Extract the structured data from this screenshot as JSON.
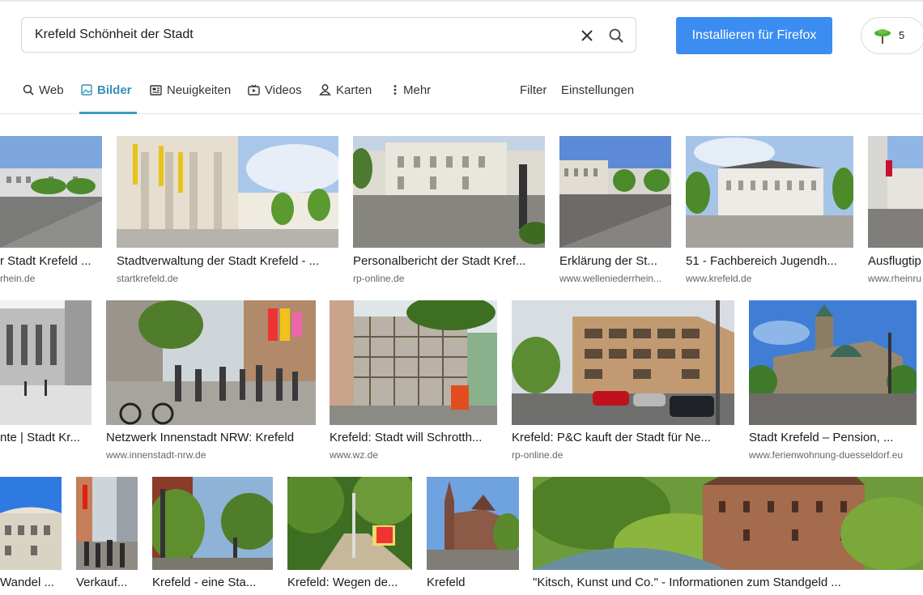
{
  "search": {
    "value": "Krefeld Schönheit der Stadt"
  },
  "install_button": "Installieren für Firefox",
  "tree_count": "5",
  "tabs": [
    {
      "label": "Web"
    },
    {
      "label": "Bilder"
    },
    {
      "label": "Neuigkeiten"
    },
    {
      "label": "Videos"
    },
    {
      "label": "Karten"
    },
    {
      "label": "Mehr"
    }
  ],
  "filter_label": "Filter",
  "settings_label": "Einstellungen",
  "row1": [
    {
      "title": "r Stadt Krefeld ...",
      "source": "rhein.de"
    },
    {
      "title": "Stadtverwaltung der Stadt Krefeld - ...",
      "source": "startkrefeld.de"
    },
    {
      "title": "Personalbericht der Stadt Kref...",
      "source": "rp-online.de"
    },
    {
      "title": "Erklärung der St...",
      "source": "www.welleniederrhein..."
    },
    {
      "title": "51 - Fachbereich Jugendh...",
      "source": "www.krefeld.de"
    },
    {
      "title": "Ausflugtip",
      "source": "www.rheinru"
    }
  ],
  "row2": [
    {
      "title": "nte | Stadt Kr...",
      "source": ""
    },
    {
      "title": "Netzwerk Innenstadt NRW: Krefeld",
      "source": "www.innenstadt-nrw.de"
    },
    {
      "title": "Krefeld: Stadt will Schrotth...",
      "source": "www.wz.de"
    },
    {
      "title": "Krefeld: P&C kauft der Stadt für Ne...",
      "source": "rp-online.de"
    },
    {
      "title": "Stadt Krefeld – Pension, ...",
      "source": "www.ferienwohnung-duesseldorf.eu"
    }
  ],
  "row3": [
    {
      "title": "Wandel ..."
    },
    {
      "title": "Verkauf..."
    },
    {
      "title": "Krefeld - eine Sta..."
    },
    {
      "title": "Krefeld: Wegen de..."
    },
    {
      "title": "Krefeld"
    },
    {
      "title": "\"Kitsch, Kunst und Co.\" - Informationen zum Standgeld ..."
    }
  ]
}
